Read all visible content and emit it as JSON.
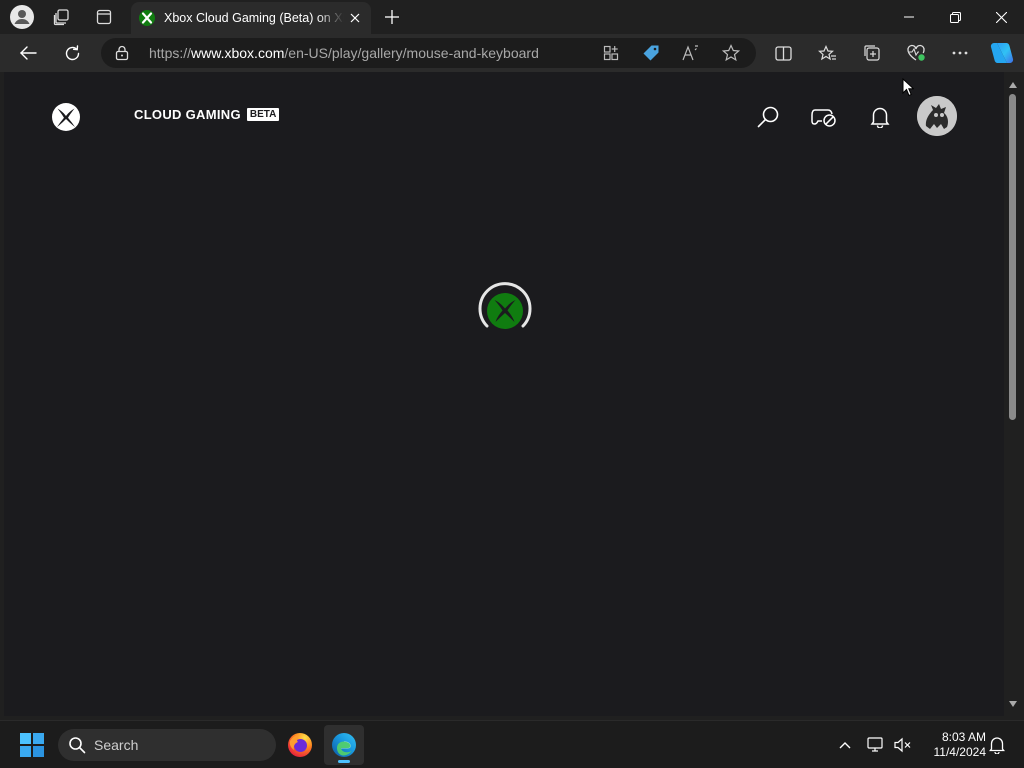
{
  "browser": {
    "tab": {
      "title": "Xbox Cloud Gaming (Beta) on Xbox.com"
    },
    "address": {
      "url_prefix": "https://",
      "url_domain": "www.xbox.com",
      "url_path": "/en-US/play/gallery/mouse-and-keyboard"
    }
  },
  "page": {
    "brand": {
      "name": "CLOUD GAMING",
      "badge": "BETA"
    }
  },
  "colors": {
    "xbox_green": "#107c10",
    "page_bg": "#1b1b1e",
    "accent": "#4cc2ff"
  },
  "taskbar": {
    "search_placeholder": "Search",
    "time": "8:03 AM",
    "date": "11/4/2024"
  }
}
